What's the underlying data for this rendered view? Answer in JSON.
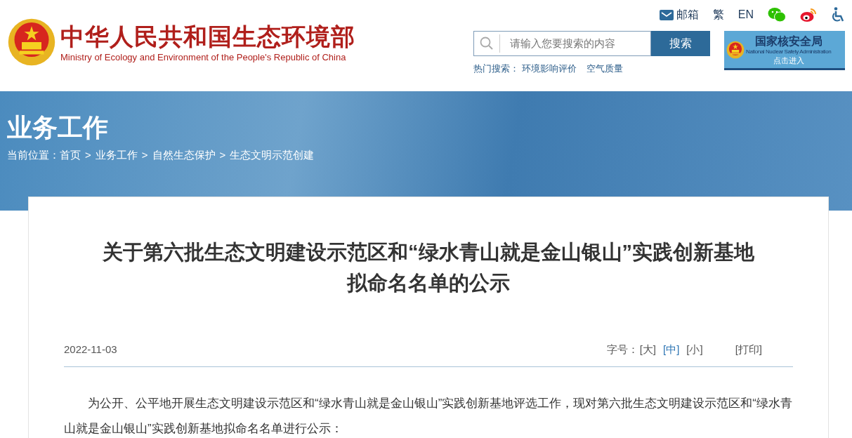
{
  "header": {
    "title": "中华人民共和国生态环境部",
    "subtitle": "Ministry of Ecology and Environment of the People's Republic of China"
  },
  "top_links": [
    {
      "kind": "mail",
      "label": "邮箱"
    },
    {
      "kind": "text",
      "label": "繁"
    },
    {
      "kind": "text",
      "label": "EN"
    },
    {
      "kind": "wechat"
    },
    {
      "kind": "weibo"
    },
    {
      "kind": "accessibility"
    }
  ],
  "search": {
    "placeholder": "请输入您要搜索的内容",
    "button": "搜索",
    "hot_label": "热门搜索：",
    "hot_links": [
      "环境影响评价",
      "空气质量"
    ]
  },
  "nnsa_banner": {
    "title": "国家核安全局",
    "subtitle": "National Nuclear Safety Administration",
    "action": "点击进入"
  },
  "section": {
    "title": "业务工作",
    "breadcrumb_label": "当前位置：",
    "breadcrumb": [
      "首页",
      "业务工作",
      "自然生态保护",
      "生态文明示范创建"
    ],
    "separator": ">"
  },
  "article": {
    "title": "关于第六批生态文明建设示范区和“绿水青山就是金山银山”实践创新基地拟命名名单的公示",
    "date": "2022-11-03",
    "font_size_label": "字号：",
    "font_sizes": [
      {
        "label": "[大]",
        "selected": false
      },
      {
        "label": "[中]",
        "selected": true
      },
      {
        "label": "[小]",
        "selected": false
      }
    ],
    "print": "[打印]",
    "paragraphs": [
      "为公开、公平地开展生态文明建设示范区和“绿水青山就是金山银山”实践创新基地评选工作，现对第六批生态文明建设示范区和“绿水青山就是金山银山”实践创新基地拟命名名单进行公示："
    ]
  }
}
